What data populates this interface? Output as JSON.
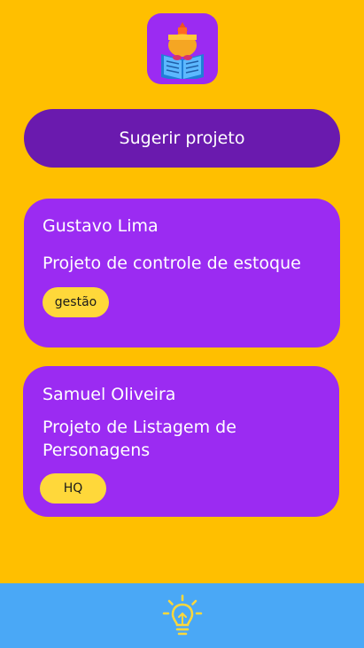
{
  "header": {
    "logo_icon": "reading-student-icon"
  },
  "actions": {
    "suggest_label": "Sugerir projeto"
  },
  "projects": [
    {
      "author": "Gustavo Lima",
      "title": "Projeto de controle de estoque",
      "tag": "gestão"
    },
    {
      "author": "Samuel Oliveira",
      "title": "Projeto de Listagem de Personagens",
      "tag": "HQ"
    }
  ],
  "bottom_nav": {
    "icon": "lightbulb-icon"
  },
  "colors": {
    "background": "#FFBF00",
    "card": "#9B2BF2",
    "button": "#6A1AAE",
    "tag": "#FFD83A",
    "bottom_bar": "#4AA8F6"
  }
}
